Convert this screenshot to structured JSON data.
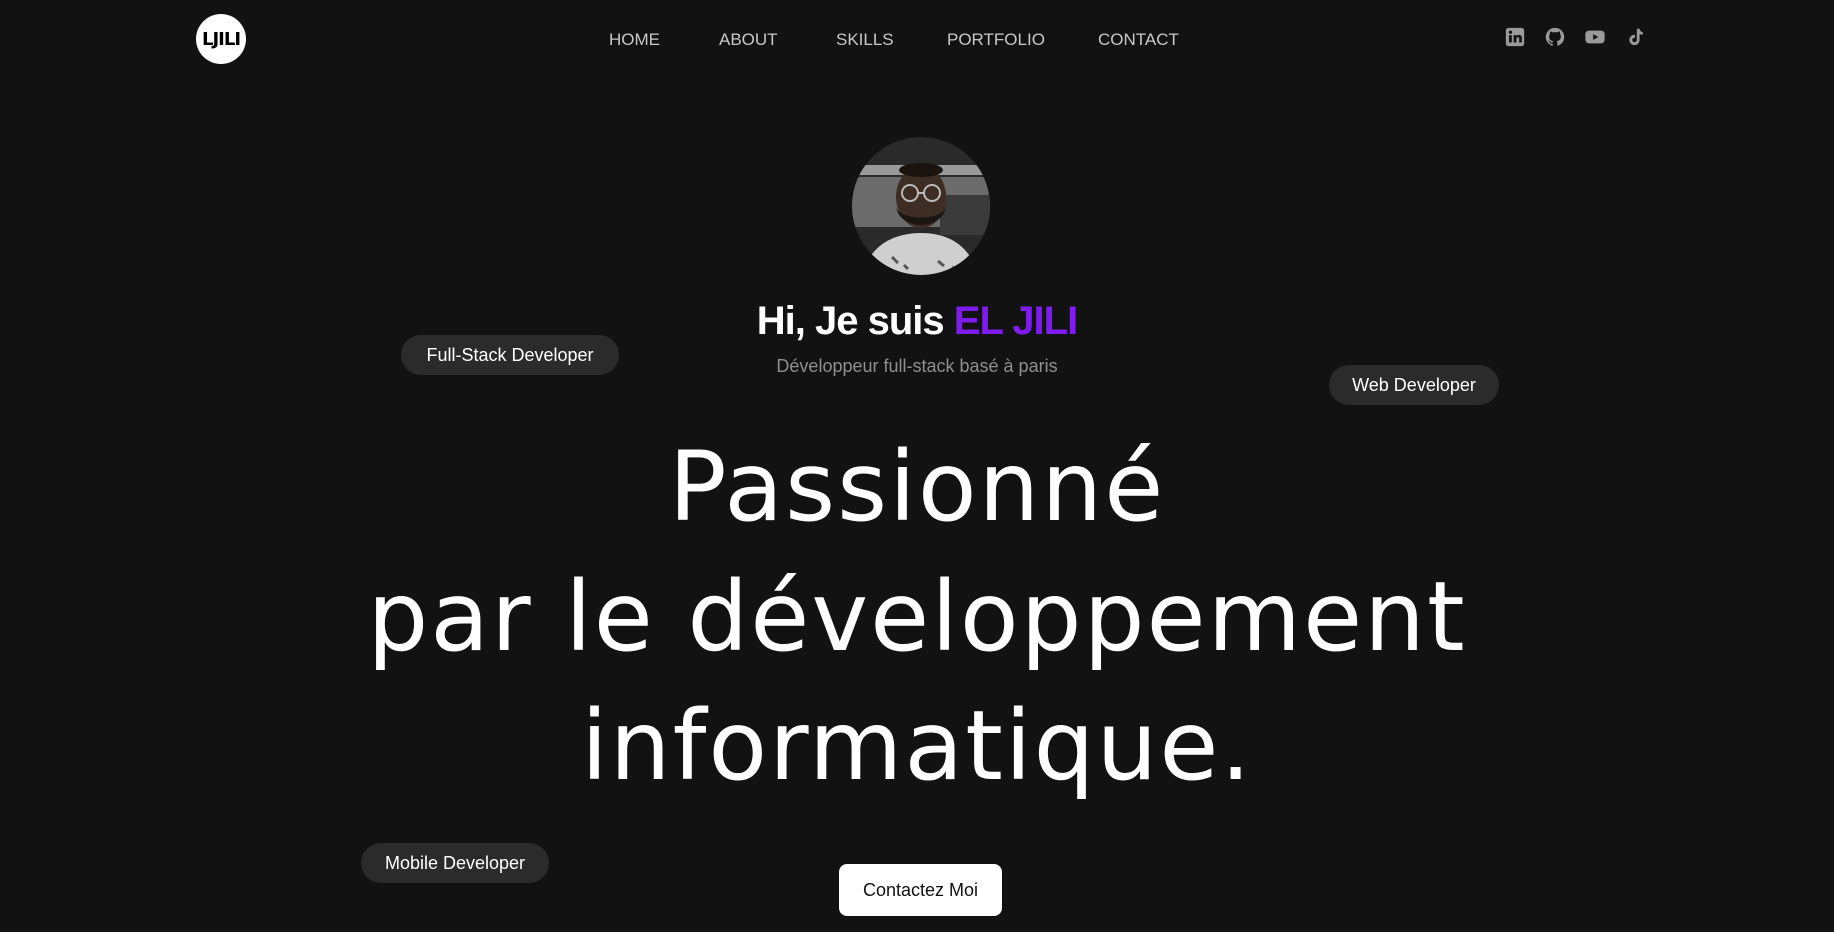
{
  "logo": {
    "text": "LJILI"
  },
  "nav": {
    "items": [
      {
        "label": "HOME"
      },
      {
        "label": "ABOUT"
      },
      {
        "label": "SKILLS"
      },
      {
        "label": "PORTFOLIO"
      },
      {
        "label": "CONTACT"
      }
    ]
  },
  "socials": [
    {
      "icon": "linkedin-icon"
    },
    {
      "icon": "github-icon"
    },
    {
      "icon": "youtube-icon"
    },
    {
      "icon": "tiktok-icon"
    }
  ],
  "hero": {
    "greeting_prefix": "Hi, Je suis ",
    "name": "EL JILI",
    "subtitle": "Développeur full-stack basé à paris",
    "headline_lines": [
      "Passionné",
      "par le développement",
      "informatique."
    ],
    "cta_label": "Contactez Moi"
  },
  "tags": [
    "Full-Stack Developer",
    "Web Developer",
    "Mobile Developer"
  ],
  "colors": {
    "background": "#121212",
    "accent": "#7e1cf0",
    "nav_text": "#c8c8c8",
    "pill_bg": "#2b2b2b"
  }
}
